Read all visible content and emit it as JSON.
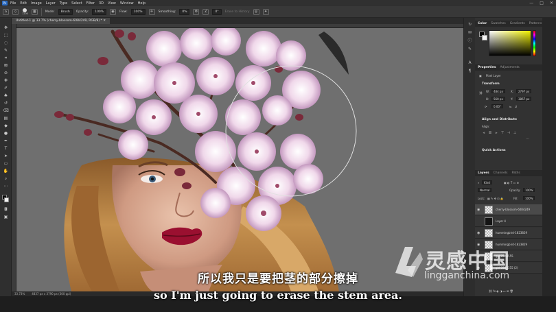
{
  "menubar": {
    "logo": "Ps",
    "items": [
      "File",
      "Edit",
      "Image",
      "Layer",
      "Type",
      "Select",
      "Filter",
      "3D",
      "View",
      "Window",
      "Help"
    ],
    "controls": [
      "—",
      "□",
      "✕"
    ]
  },
  "options": {
    "brush_size": "1200",
    "mode_label": "Mode:",
    "mode_value": "Brush",
    "opacity_label": "Opacity:",
    "opacity_value": "100%",
    "flow_label": "Flow:",
    "flow_value": "100%",
    "smoothing_label": "Smoothing:",
    "smoothing_value": "0%",
    "angle_value": "0°",
    "history_label": "Erase to History"
  },
  "document": {
    "tab_title": "Untitled-1 @ 33.7% (cherry-blossom-6084249, RGB/8) *",
    "zoom": "33.73%",
    "size": "4837 px x 3790 px (300 ppi)"
  },
  "color_panel": {
    "tabs": [
      "Color",
      "Swatches",
      "Gradients",
      "Patterns"
    ]
  },
  "properties_panel": {
    "tabs": [
      "Properties",
      "Adjustments"
    ],
    "layer_type": "Pixel Layer",
    "transform_label": "Transform",
    "w_label": "W:",
    "w_value": "484 px",
    "h_label": "H:",
    "h_value": "560 px",
    "x_label": "X:",
    "x_value": "2797 px",
    "y_label": "Y:",
    "y_value": "3867 px",
    "angle_value": "0.00°",
    "align_label": "Align and Distribute",
    "align_sub": "Align:",
    "quick_actions_label": "Quick Actions"
  },
  "layers_panel": {
    "tabs": [
      "Layers",
      "Channels",
      "Paths"
    ],
    "filter_kind": "Kind",
    "blend_mode": "Normal",
    "opacity_label": "Opacity:",
    "opacity_value": "100%",
    "lock_label": "Lock:",
    "fill_label": "Fill:",
    "fill_value": "100%",
    "layers": [
      {
        "name": "cherry-blossom-6084249",
        "visible": true,
        "dark": false
      },
      {
        "name": "Layer 4",
        "visible": false,
        "dark": true
      },
      {
        "name": "hummingbird-1823829",
        "visible": true,
        "dark": false
      },
      {
        "name": "hummingbird-1823829",
        "visible": true,
        "dark": false
      },
      {
        "name": "girl-2848555",
        "visible": true,
        "dark": false
      },
      {
        "name": "girl-2848555 (2)",
        "visible": true,
        "dark": false
      }
    ]
  },
  "subtitles": {
    "chinese": "所以我只是要把茎的部分擦掉",
    "english": "so I'm just going to erase the stem area."
  },
  "watermark": {
    "title": "灵感中国",
    "url": "lingganchina.com"
  },
  "colors": {
    "foreground": "#050505",
    "background": "#f5f5f5",
    "canvas_bg": "#6f6f6f",
    "blossom": "#e8c6de",
    "lips": "#9a1030",
    "hair": "#b88448"
  }
}
